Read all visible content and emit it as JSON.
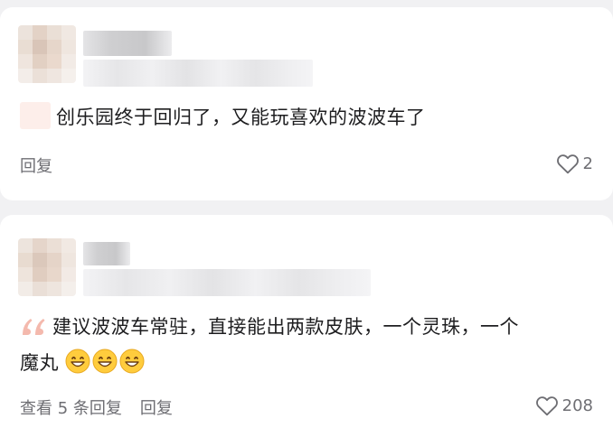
{
  "comments": [
    {
      "text": "创乐园终于回归了，又能玩喜欢的波波车了",
      "actions": {
        "reply": "回复"
      },
      "likes": "2"
    },
    {
      "text_line1": "建议波波车常驻，直接能出两款皮肤，一个灵珠，一个",
      "text_line2": "魔丸",
      "emojis": [
        "grinning-face-emoji",
        "grinning-face-emoji",
        "grinning-face-emoji"
      ],
      "actions": {
        "view_replies": "查看 5 条回复",
        "reply": "回复"
      },
      "likes": "208"
    }
  ],
  "colors": {
    "background": "#f1f1f3",
    "card": "#ffffff",
    "text": "#1d1d1f",
    "secondary": "#6e6e73",
    "quote_accent": "#f4b9ad"
  }
}
